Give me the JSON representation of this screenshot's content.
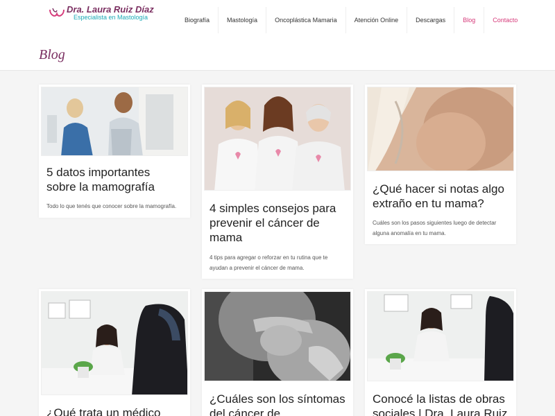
{
  "header": {
    "logo_name": "Dra. Laura Ruiz Díaz",
    "logo_subtitle": "Especialista en Mastología"
  },
  "nav": {
    "items": [
      {
        "label": "Biografía"
      },
      {
        "label": "Mastología"
      },
      {
        "label": "Oncoplástica Mamaria"
      },
      {
        "label": "Atención Online"
      },
      {
        "label": "Descargas"
      },
      {
        "label": "Blog"
      },
      {
        "label": "Contacto"
      }
    ]
  },
  "page": {
    "title": "Blog"
  },
  "posts": [
    {
      "title": "5 datos importantes sobre la mamografía",
      "excerpt": "Todo lo que tenés que conocer sobre la mamografía."
    },
    {
      "title": "4 simples consejos para prevenir el cáncer de mama",
      "excerpt": "4 tips para agregar o reforzar en tu rutina que te ayudan a prevenir el cáncer de mama."
    },
    {
      "title": "¿Qué hacer si notas algo extraño en tu mama?",
      "excerpt": "Cuáles son los pasos siguientes luego de detectar alguna anomalía en tu mama."
    },
    {
      "title": "¿Qué trata un médico",
      "excerpt": ""
    },
    {
      "title": "¿Cuáles son los síntomas del cáncer de",
      "excerpt": ""
    },
    {
      "title": "Conocé la listas de obras sociales | Dra. Laura Ruiz",
      "excerpt": ""
    }
  ],
  "colors": {
    "brand": "#7a2e60",
    "accent": "#d63a7a",
    "teal": "#1aa9b5",
    "background": "#f5f5f5"
  }
}
